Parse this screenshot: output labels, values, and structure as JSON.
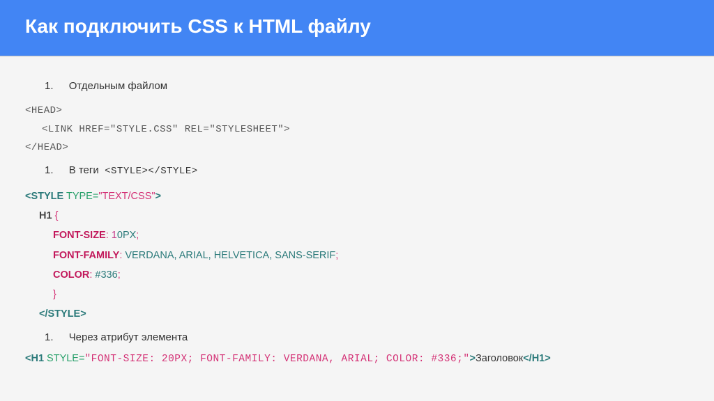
{
  "header": {
    "title": "Как подключить CSS к HTML файлу"
  },
  "items": {
    "one": {
      "num": "1.",
      "label": "Отдельным файлом"
    },
    "two": {
      "num": "1.",
      "label": "В теги",
      "inline_code": "<STYLE></STYLE>"
    },
    "three": {
      "num": "1.",
      "label": "Через атрибут элемента"
    }
  },
  "code_head": {
    "open": "<HEAD>",
    "link": "<LINK HREF=\"STYLE.CSS\" REL=\"STYLESHEET\">",
    "close": "</HEAD>"
  },
  "style_block": {
    "open_tag": "<STYLE",
    "attr_name": "TYPE",
    "attr_eq": "=",
    "attr_val": "\"TEXT/CSS\"",
    "open_tag_end": ">",
    "selector": "H1",
    "brace_open": "{",
    "props": {
      "font_size": {
        "name": "FONT-SIZE",
        "colon": ":",
        "num": "1",
        "rest": "0PX",
        "semi": ";"
      },
      "font_family": {
        "name": "FONT-FAMILY",
        "colon": ":",
        "val": "VERDANA, ARIAL, HELVETICA, SANS-SERIF",
        "semi": ";"
      },
      "color": {
        "name": "COLOR",
        "colon": ":",
        "val": "#336",
        "semi": ";"
      }
    },
    "brace_close": "}",
    "close_tag": "</STYLE>"
  },
  "inline_h1": {
    "open": "<H1",
    "attr": "STYLE",
    "eq": "=",
    "val": "\"FONT-SIZE: 20PX; FONT-FAMILY: VERDANA, ARIAL; COLOR: #336;\"",
    "gt": ">",
    "text": "Заголовок",
    "close": "</H1>"
  }
}
